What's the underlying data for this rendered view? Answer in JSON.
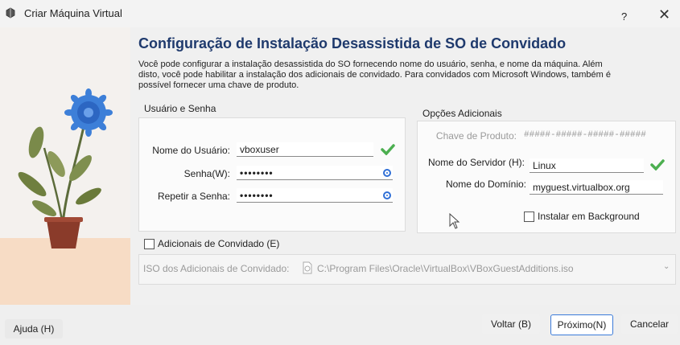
{
  "window": {
    "title": "Criar Máquina Virtual",
    "help_label": "?",
    "close_label": "✕"
  },
  "heading": "Configuração de Instalação Desassistida de SO de Convidado",
  "description": "Você pode configurar a instalação desassistida do SO fornecendo nome do usuário, senha, e nome da máquina. Além disto, você pode habilitar a instalação dos adicionais de convidado. Para convidados com Microsoft Windows, também é possível fornecer uma chave de produto.",
  "user_group": {
    "title": "Usuário e Senha",
    "username_label": "Nome do Usuário:",
    "username_value": "vboxuser",
    "password_label": "Senha(W):",
    "password_value": "••••••••",
    "repeat_label": "Repetir a Senha:",
    "repeat_value": "••••••••"
  },
  "additional_group": {
    "title": "Opções Adicionais",
    "product_key_label": "Chave de Produto:",
    "product_key_value": "#####-#####-#####-#####",
    "hostname_label": "Nome do Servidor (H):",
    "hostname_value": "Linux",
    "domain_label": "Nome do Domínio:",
    "domain_value": "myguest.virtualbox.org",
    "background_label": "Instalar em Background"
  },
  "guest_additions": {
    "checkbox_label": "Adicionais de Convidado (E)",
    "iso_label": "ISO dos Adicionais de Convidado:",
    "iso_path": "C:\\Program Files\\Oracle\\VirtualBox\\VBoxGuestAdditions.iso"
  },
  "buttons": {
    "help": "Ajuda (H)",
    "back": "Voltar (B)",
    "next": "Próximo(N)",
    "cancel": "Cancelar"
  },
  "colors": {
    "accent": "#3b7bd9",
    "heading": "#1f3a6d",
    "ok_check": "#4caf50"
  }
}
